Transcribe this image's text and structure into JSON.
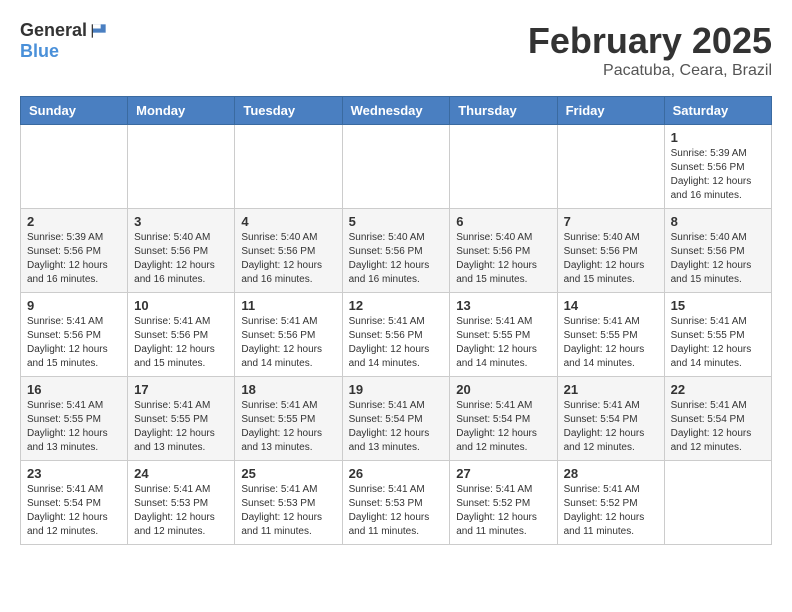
{
  "header": {
    "logo_general": "General",
    "logo_blue": "Blue",
    "month_year": "February 2025",
    "location": "Pacatuba, Ceara, Brazil"
  },
  "days_of_week": [
    "Sunday",
    "Monday",
    "Tuesday",
    "Wednesday",
    "Thursday",
    "Friday",
    "Saturday"
  ],
  "weeks": [
    [
      {
        "day": "",
        "info": ""
      },
      {
        "day": "",
        "info": ""
      },
      {
        "day": "",
        "info": ""
      },
      {
        "day": "",
        "info": ""
      },
      {
        "day": "",
        "info": ""
      },
      {
        "day": "",
        "info": ""
      },
      {
        "day": "1",
        "info": "Sunrise: 5:39 AM\nSunset: 5:56 PM\nDaylight: 12 hours\nand 16 minutes."
      }
    ],
    [
      {
        "day": "2",
        "info": "Sunrise: 5:39 AM\nSunset: 5:56 PM\nDaylight: 12 hours\nand 16 minutes."
      },
      {
        "day": "3",
        "info": "Sunrise: 5:40 AM\nSunset: 5:56 PM\nDaylight: 12 hours\nand 16 minutes."
      },
      {
        "day": "4",
        "info": "Sunrise: 5:40 AM\nSunset: 5:56 PM\nDaylight: 12 hours\nand 16 minutes."
      },
      {
        "day": "5",
        "info": "Sunrise: 5:40 AM\nSunset: 5:56 PM\nDaylight: 12 hours\nand 16 minutes."
      },
      {
        "day": "6",
        "info": "Sunrise: 5:40 AM\nSunset: 5:56 PM\nDaylight: 12 hours\nand 15 minutes."
      },
      {
        "day": "7",
        "info": "Sunrise: 5:40 AM\nSunset: 5:56 PM\nDaylight: 12 hours\nand 15 minutes."
      },
      {
        "day": "8",
        "info": "Sunrise: 5:40 AM\nSunset: 5:56 PM\nDaylight: 12 hours\nand 15 minutes."
      }
    ],
    [
      {
        "day": "9",
        "info": "Sunrise: 5:41 AM\nSunset: 5:56 PM\nDaylight: 12 hours\nand 15 minutes."
      },
      {
        "day": "10",
        "info": "Sunrise: 5:41 AM\nSunset: 5:56 PM\nDaylight: 12 hours\nand 15 minutes."
      },
      {
        "day": "11",
        "info": "Sunrise: 5:41 AM\nSunset: 5:56 PM\nDaylight: 12 hours\nand 14 minutes."
      },
      {
        "day": "12",
        "info": "Sunrise: 5:41 AM\nSunset: 5:56 PM\nDaylight: 12 hours\nand 14 minutes."
      },
      {
        "day": "13",
        "info": "Sunrise: 5:41 AM\nSunset: 5:55 PM\nDaylight: 12 hours\nand 14 minutes."
      },
      {
        "day": "14",
        "info": "Sunrise: 5:41 AM\nSunset: 5:55 PM\nDaylight: 12 hours\nand 14 minutes."
      },
      {
        "day": "15",
        "info": "Sunrise: 5:41 AM\nSunset: 5:55 PM\nDaylight: 12 hours\nand 14 minutes."
      }
    ],
    [
      {
        "day": "16",
        "info": "Sunrise: 5:41 AM\nSunset: 5:55 PM\nDaylight: 12 hours\nand 13 minutes."
      },
      {
        "day": "17",
        "info": "Sunrise: 5:41 AM\nSunset: 5:55 PM\nDaylight: 12 hours\nand 13 minutes."
      },
      {
        "day": "18",
        "info": "Sunrise: 5:41 AM\nSunset: 5:55 PM\nDaylight: 12 hours\nand 13 minutes."
      },
      {
        "day": "19",
        "info": "Sunrise: 5:41 AM\nSunset: 5:54 PM\nDaylight: 12 hours\nand 13 minutes."
      },
      {
        "day": "20",
        "info": "Sunrise: 5:41 AM\nSunset: 5:54 PM\nDaylight: 12 hours\nand 12 minutes."
      },
      {
        "day": "21",
        "info": "Sunrise: 5:41 AM\nSunset: 5:54 PM\nDaylight: 12 hours\nand 12 minutes."
      },
      {
        "day": "22",
        "info": "Sunrise: 5:41 AM\nSunset: 5:54 PM\nDaylight: 12 hours\nand 12 minutes."
      }
    ],
    [
      {
        "day": "23",
        "info": "Sunrise: 5:41 AM\nSunset: 5:54 PM\nDaylight: 12 hours\nand 12 minutes."
      },
      {
        "day": "24",
        "info": "Sunrise: 5:41 AM\nSunset: 5:53 PM\nDaylight: 12 hours\nand 12 minutes."
      },
      {
        "day": "25",
        "info": "Sunrise: 5:41 AM\nSunset: 5:53 PM\nDaylight: 12 hours\nand 11 minutes."
      },
      {
        "day": "26",
        "info": "Sunrise: 5:41 AM\nSunset: 5:53 PM\nDaylight: 12 hours\nand 11 minutes."
      },
      {
        "day": "27",
        "info": "Sunrise: 5:41 AM\nSunset: 5:52 PM\nDaylight: 12 hours\nand 11 minutes."
      },
      {
        "day": "28",
        "info": "Sunrise: 5:41 AM\nSunset: 5:52 PM\nDaylight: 12 hours\nand 11 minutes."
      },
      {
        "day": "",
        "info": ""
      }
    ]
  ]
}
